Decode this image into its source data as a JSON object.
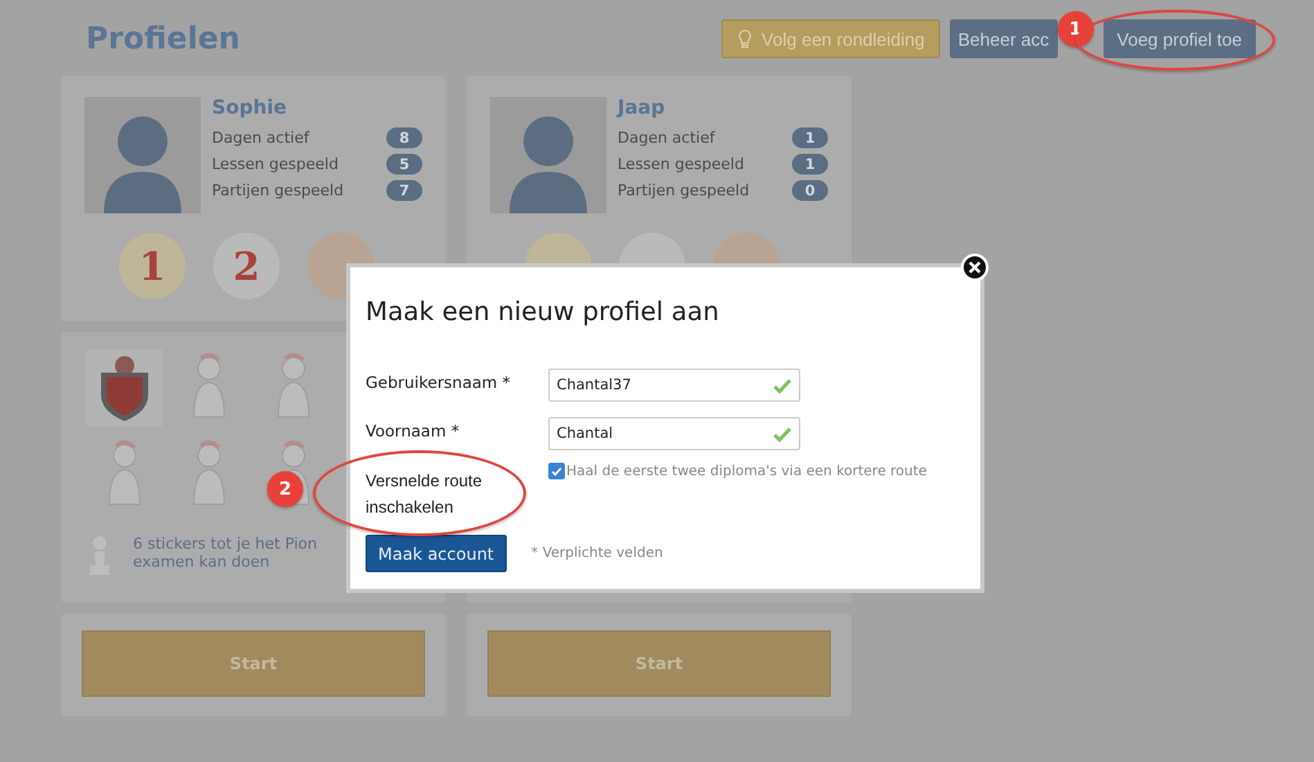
{
  "page": {
    "title": "Profielen"
  },
  "header_buttons": [
    {
      "label": "Volg een rondleiding",
      "kind": "tour"
    },
    {
      "label": "Beheer acc",
      "kind": "primary"
    },
    {
      "label": "Voeg profiel toe",
      "kind": "primary"
    }
  ],
  "profiles": [
    {
      "name": "Sophie",
      "stats": [
        {
          "label": "Dagen actief",
          "value": "8"
        },
        {
          "label": "Lessen gespeeld",
          "value": "5"
        },
        {
          "label": "Partijen gespeeld",
          "value": "7"
        }
      ],
      "medals": [
        "1",
        "2"
      ],
      "stickers": [
        {
          "earned": true
        },
        {
          "earned": false
        },
        {
          "earned": false
        },
        {
          "earned": false
        },
        {
          "earned": false
        },
        {
          "earned": false
        }
      ],
      "progress_text": "6 stickers tot je het Pion examen kan doen",
      "start": "Start"
    },
    {
      "name": "Jaap",
      "stats": [
        {
          "label": "Dagen actief",
          "value": "1"
        },
        {
          "label": "Lessen gespeeld",
          "value": "1"
        },
        {
          "label": "Partijen gespeeld",
          "value": "0"
        }
      ],
      "start": "Start"
    }
  ],
  "dialog": {
    "title": "Maak een nieuw profiel aan",
    "fields": [
      {
        "label": "Gebruikersnaam *",
        "value": "Chantal37",
        "valid": true
      },
      {
        "label": "Voornaam *",
        "value": "Chantal",
        "valid": true
      }
    ],
    "option": {
      "label": "Versnelde route inschakelen",
      "text": "Haal de eerste twee diploma's via een kortere route",
      "checked": true
    },
    "submit": "Maak account",
    "note": "* Verplichte velden"
  },
  "annotations": [
    {
      "number": "1"
    },
    {
      "number": "2"
    }
  ]
}
